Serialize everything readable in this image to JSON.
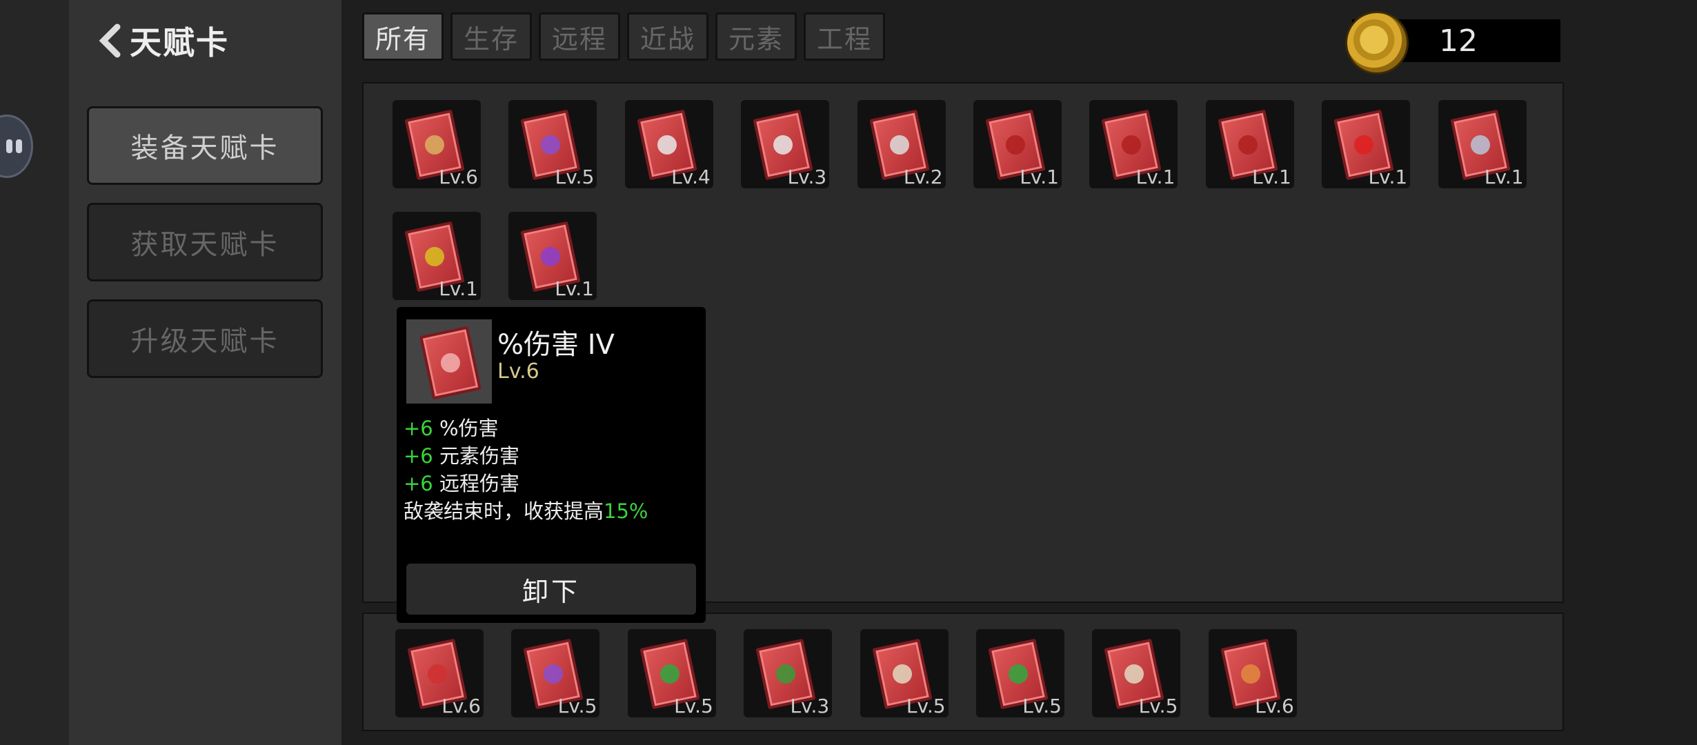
{
  "header": {
    "title": "天赋卡",
    "coins": "12"
  },
  "sidebar": {
    "items": [
      {
        "label": "装备天赋卡"
      },
      {
        "label": "获取天赋卡"
      },
      {
        "label": "升级天赋卡"
      }
    ]
  },
  "tabs": [
    "所有",
    "生存",
    "远程",
    "近战",
    "元素",
    "工程"
  ],
  "owned_cards": [
    {
      "level": "Lv.6",
      "icon": "wheat-icon"
    },
    {
      "level": "Lv.5",
      "icon": "purple-rune-icon"
    },
    {
      "level": "Lv.4",
      "icon": "boot-icon"
    },
    {
      "level": "Lv.3",
      "icon": "boot-icon"
    },
    {
      "level": "Lv.2",
      "icon": "hourglass-icon"
    },
    {
      "level": "Lv.1",
      "icon": "target-icon"
    },
    {
      "level": "Lv.1",
      "icon": "target-icon"
    },
    {
      "level": "Lv.1",
      "icon": "target-icon"
    },
    {
      "level": "Lv.1",
      "icon": "star-burst-icon"
    },
    {
      "level": "Lv.1",
      "icon": "wind-icon"
    },
    {
      "level": "Lv.1",
      "icon": "shield-icon"
    },
    {
      "level": "Lv.1",
      "icon": "wifi-icon"
    }
  ],
  "equipped_cards": [
    {
      "level": "Lv.6",
      "icon": "burst-icon"
    },
    {
      "level": "Lv.5",
      "icon": "purple-rune-icon"
    },
    {
      "level": "Lv.5",
      "icon": "heart-icon"
    },
    {
      "level": "Lv.3",
      "icon": "heart-sword-icon"
    },
    {
      "level": "Lv.5",
      "icon": "sword-icon"
    },
    {
      "level": "Lv.5",
      "icon": "heart-icon"
    },
    {
      "level": "Lv.5",
      "icon": "sword-icon"
    },
    {
      "level": "Lv.6",
      "icon": "flame-icon"
    }
  ],
  "popup": {
    "name": "%伤害 IV",
    "level": "Lv.6",
    "stats": [
      {
        "value": "+6",
        "text": " %伤害"
      },
      {
        "value": "+6",
        "text": " 元素伤害"
      },
      {
        "value": "+6",
        "text": " 远程伤害"
      }
    ],
    "effect_text": "敌袭结束时，收获提高",
    "effect_value": "15%",
    "button_label": "卸下"
  },
  "colors": {
    "accent_green": "#3ad23a",
    "card_red": "#d84a4f",
    "level_gold": "#d8c98a"
  }
}
